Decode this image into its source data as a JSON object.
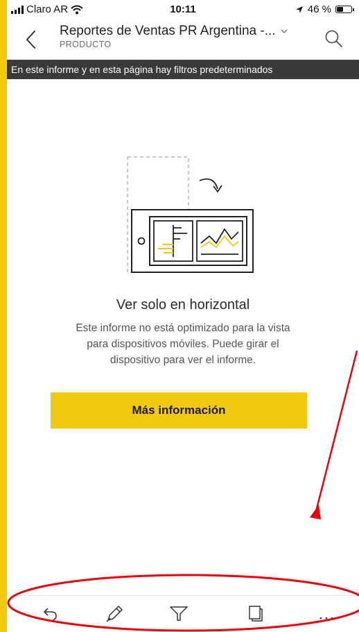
{
  "status_bar": {
    "carrier": "Claro AR",
    "time": "10:11",
    "battery": "46 %",
    "battery_level": 0.46
  },
  "header": {
    "title": "Reportes de Ventas PR Argentina -...",
    "subtitle": "PRODUCTO",
    "icons": {
      "back": "chevron-left-icon",
      "dropdown": "chevron-down-icon",
      "search": "search-icon"
    }
  },
  "filter_banner": {
    "text": "En este informe y en esta página hay filtros predeterminados"
  },
  "message": {
    "title": "Ver solo en horizontal",
    "body": "Este informe no está optimizado para la vista para dispositivos móviles. Puede girar el dispositivo para ver el informe."
  },
  "primary_button": {
    "label": "Más información"
  },
  "toolbar": {
    "items": [
      {
        "name": "undo",
        "icon": "undo-icon"
      },
      {
        "name": "annotate",
        "icon": "pen-icon"
      },
      {
        "name": "filter",
        "icon": "filter-icon"
      },
      {
        "name": "pages",
        "icon": "pages-icon"
      },
      {
        "name": "more",
        "icon": "more-icon"
      }
    ]
  },
  "colors": {
    "accent": "#F2C811",
    "banner": "#3A3A3A",
    "annotation": "#E8000B"
  }
}
